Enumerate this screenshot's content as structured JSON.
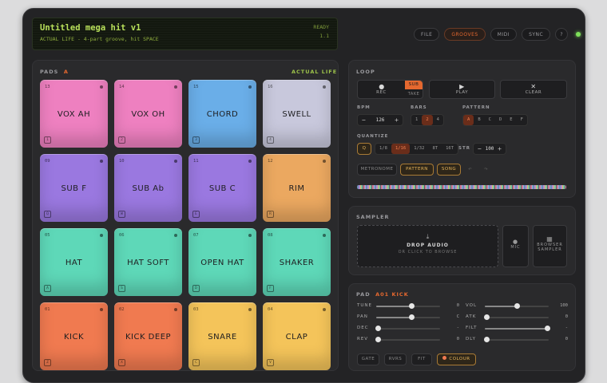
{
  "lcd": {
    "title": "Untitled mega hit v1",
    "subtitle": "ACTUAL LIFE - 4-part groove, hit SPACE",
    "status": "READY",
    "version": "1.1"
  },
  "topbar": {
    "buttons": [
      "FILE",
      "GROOVES",
      "MIDI",
      "SYNC",
      "?"
    ],
    "active": "GROOVES"
  },
  "pads_panel": {
    "title": "PADS",
    "bank": "A",
    "kit": "ACTUAL LIFE",
    "pads": [
      {
        "num": "13",
        "label": "VOX AH",
        "key": "1"
      },
      {
        "num": "14",
        "label": "VOX OH",
        "key": "2"
      },
      {
        "num": "15",
        "label": "CHORD",
        "key": "3"
      },
      {
        "num": "16",
        "label": "SWELL",
        "key": "4"
      },
      {
        "num": "09",
        "label": "SUB F",
        "key": "Q"
      },
      {
        "num": "10",
        "label": "SUB Ab",
        "key": "W"
      },
      {
        "num": "11",
        "label": "SUB C",
        "key": "E"
      },
      {
        "num": "12",
        "label": "RIM",
        "key": "R"
      },
      {
        "num": "05",
        "label": "HAT",
        "key": "A"
      },
      {
        "num": "06",
        "label": "HAT SOFT",
        "key": "S"
      },
      {
        "num": "07",
        "label": "OPEN HAT",
        "key": "D"
      },
      {
        "num": "08",
        "label": "SHAKER",
        "key": "F"
      },
      {
        "num": "01",
        "label": "KICK",
        "key": "Z"
      },
      {
        "num": "02",
        "label": "KICK DEEP",
        "key": "X"
      },
      {
        "num": "03",
        "label": "SNARE",
        "key": "C"
      },
      {
        "num": "04",
        "label": "CLAP",
        "key": "V"
      }
    ],
    "colors": [
      "#ee80c0",
      "#ee80c0",
      "#6aaee8",
      "#c8c8dc",
      "#9a78e0",
      "#9a78e0",
      "#9a78e0",
      "#eba860",
      "#5ed8b8",
      "#5ed8b8",
      "#5ed8b8",
      "#5ed8b8",
      "#f07a50",
      "#f07a50",
      "#f4c45a",
      "#f4c45a"
    ]
  },
  "loop": {
    "title": "LOOP",
    "rec": "REC",
    "sub": "SUB",
    "take": "TAKE",
    "play": "PLAY",
    "clear": "CLEAR",
    "bpm_label": "BPM",
    "bpm": "126",
    "bars_label": "BARS",
    "bars": [
      "1",
      "2",
      "4"
    ],
    "bars_on": "2",
    "pattern_label": "PATTERN",
    "patterns": [
      "A",
      "B",
      "C",
      "D",
      "E",
      "F"
    ],
    "pattern_on": "A",
    "quantize_label": "QUANTIZE",
    "q": "Q",
    "quantize": [
      "1/8",
      "1/16",
      "1/32",
      "8T",
      "16T"
    ],
    "quantize_on": "1/16",
    "str_label": "STR",
    "str": "100",
    "metronome": "METRONOME",
    "pattern_btn": "PATTERN",
    "song_btn": "SONG"
  },
  "sampler": {
    "title": "SAMPLER",
    "drop": "DROP AUDIO",
    "drop_sub": "OR CLICK TO BROWSE",
    "mic": "MIC",
    "browser": "BROWSER",
    "browser2": "SAMPLER"
  },
  "pad_edit": {
    "title": "PAD",
    "pad_id": "A01 KICK",
    "left": [
      {
        "label": "TUNE",
        "value": "0",
        "pos": 0.55
      },
      {
        "label": "PAN",
        "value": "C",
        "pos": 0.55
      },
      {
        "label": "DEC",
        "value": "-",
        "pos": 0.03
      },
      {
        "label": "REV",
        "value": "0",
        "pos": 0.03
      }
    ],
    "right": [
      {
        "label": "VOL",
        "value": "100",
        "pos": 0.5
      },
      {
        "label": "ATK",
        "value": "0",
        "pos": 0.03
      },
      {
        "label": "FILT",
        "value": "-",
        "pos": 0.97
      },
      {
        "label": "DLY",
        "value": "0",
        "pos": 0.03
      }
    ],
    "buttons": [
      "GATE",
      "RVRS",
      "FIT",
      "COLOUR"
    ]
  }
}
